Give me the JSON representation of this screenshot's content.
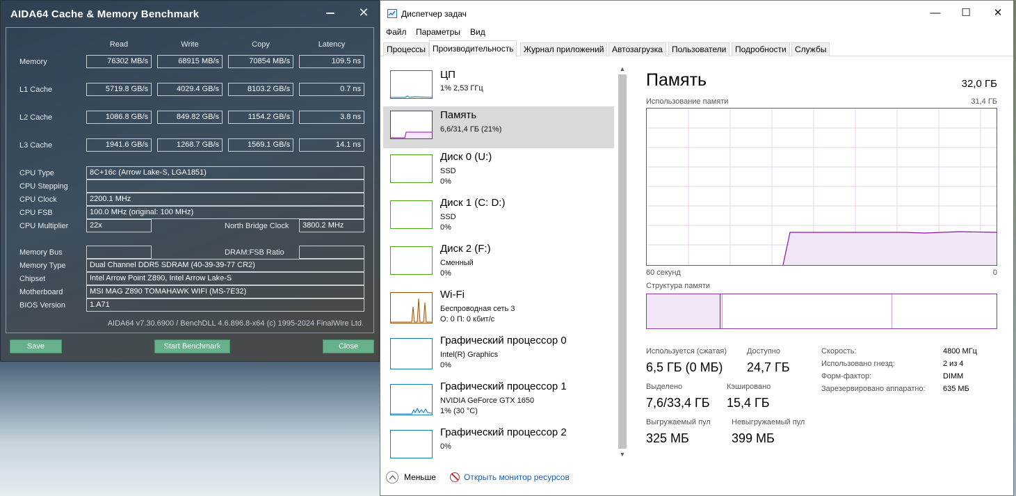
{
  "aida": {
    "title": "AIDA64 Cache & Memory Benchmark",
    "columns": [
      "Read",
      "Write",
      "Copy",
      "Latency"
    ],
    "bench_rows": [
      {
        "label": "Memory",
        "read": "76302 MB/s",
        "write": "68915 MB/s",
        "copy": "70854 MB/s",
        "latency": "109.5 ns"
      },
      {
        "label": "L1 Cache",
        "read": "5719.8 GB/s",
        "write": "4029.4 GB/s",
        "copy": "8103.2 GB/s",
        "latency": "0.7 ns"
      },
      {
        "label": "L2 Cache",
        "read": "1086.8 GB/s",
        "write": "849.82 GB/s",
        "copy": "1154.2 GB/s",
        "latency": "3.8 ns"
      },
      {
        "label": "L3 Cache",
        "read": "1941.6 GB/s",
        "write": "1268.7 GB/s",
        "copy": "1569.1 GB/s",
        "latency": "14.1 ns"
      }
    ],
    "cpu": {
      "type_label": "CPU Type",
      "type_value": "8C+16c   (Arrow Lake-S, LGA1851)",
      "stepping_label": "CPU Stepping",
      "stepping_value": "",
      "clock_label": "CPU Clock",
      "clock_value": "2200.1 MHz",
      "fsb_label": "CPU FSB",
      "fsb_value": "100.0 MHz  (original: 100 MHz)",
      "mult_label": "CPU Multiplier",
      "mult_value": "22x",
      "nb_label": "North Bridge Clock",
      "nb_value": "3800.2 MHz"
    },
    "mem": {
      "bus_label": "Memory Bus",
      "bus_value": "",
      "ratio_label": "DRAM:FSB Ratio",
      "ratio_value": "",
      "type_label": "Memory Type",
      "type_value": "Dual Channel DDR5 SDRAM  (40-39-39-77 CR2)",
      "chipset_label": "Chipset",
      "chipset_value": "Intel Arrow Point Z890, Intel Arrow Lake-S",
      "mb_label": "Motherboard",
      "mb_value": "MSI MAG Z890 TOMAHAWK WIFI (MS-7E32)",
      "bios_label": "BIOS Version",
      "bios_value": "1.A71"
    },
    "footer": "AIDA64 v7.30.6900 / BenchDLL 4.6.896.8-x64  (c) 1995-2024 FinalWire Ltd.",
    "buttons": {
      "save": "Save",
      "start": "Start Benchmark",
      "close": "Close"
    },
    "window_close_glyph": "✕"
  },
  "tm": {
    "title": "Диспетчер задач",
    "caption": {
      "min": "—",
      "max": "☐",
      "close": "✕"
    },
    "menu": [
      "Файл",
      "Параметры",
      "Вид"
    ],
    "tabs": [
      "Процессы",
      "Производительность",
      "Журнал приложений",
      "Автозагрузка",
      "Пользователи",
      "Подробности",
      "Службы"
    ],
    "active_tab": "Производительность",
    "items": [
      {
        "name": "ЦП",
        "sub1": "1% 2,53 ГГц",
        "sub2": "",
        "color": "#117dbb"
      },
      {
        "name": "Память",
        "sub1": "6,6/31,4 ГБ (21%)",
        "sub2": "",
        "color": "#8b12ae"
      },
      {
        "name": "Диск 0 (U:)",
        "sub1": "SSD",
        "sub2": "0%",
        "color": "#4da60c"
      },
      {
        "name": "Диск 1 (C: D:)",
        "sub1": "SSD",
        "sub2": "0%",
        "color": "#4da60c"
      },
      {
        "name": "Диск 2 (F:)",
        "sub1": "Сменный",
        "sub2": "0%",
        "color": "#4da60c"
      },
      {
        "name": "Wi-Fi",
        "sub1": "Беспроводная сеть 3",
        "sub2": "О: 0 П: 0 кбит/с",
        "color": "#a74f01"
      },
      {
        "name": "Графический процессор 0",
        "sub1": "Intel(R) Graphics",
        "sub2": "0%",
        "color": "#117dbb"
      },
      {
        "name": "Графический процессор 1",
        "sub1": "NVIDIA GeForce GTX 1650",
        "sub2": "1% (30 °C)",
        "color": "#117dbb"
      },
      {
        "name": "Графический процессор 2",
        "sub1": "0%",
        "sub2": "",
        "color": "#117dbb"
      }
    ],
    "scroll": {
      "up": "▲",
      "down": "▼"
    },
    "memory": {
      "title": "Память",
      "total": "32,0 ГБ",
      "usage_label": "Использование памяти",
      "usage_max": "31,4 ГБ",
      "axis_left": "60 секунд",
      "axis_right": "0",
      "usage_fraction": 0.21,
      "structure_label": "Структура памяти",
      "in_use_label": "Используется (сжатая)",
      "in_use_value": "6,5 ГБ (0 МБ)",
      "available_label": "Доступно",
      "available_value": "24,7 ГБ",
      "committed_label": "Выделено",
      "committed_value": "7,6/33,4 ГБ",
      "cached_label": "Кэшировано",
      "cached_value": "15,4 ГБ",
      "paged_label": "Выгружаемый пул",
      "paged_value": "325 МБ",
      "nonpaged_label": "Невыгружаемый пул",
      "nonpaged_value": "399 МБ",
      "speed_label": "Скорость:",
      "speed_value": "4800 МГц",
      "slots_label": "Использовано гнезд:",
      "slots_value": "2 из 4",
      "form_label": "Форм-фактор:",
      "form_value": "DIMM",
      "reserved_label": "Зарезервировано аппаратно:",
      "reserved_value": "635 МБ"
    },
    "bottom": {
      "fewer": "Меньше",
      "resmon": "Открыть монитор ресурсов"
    }
  }
}
